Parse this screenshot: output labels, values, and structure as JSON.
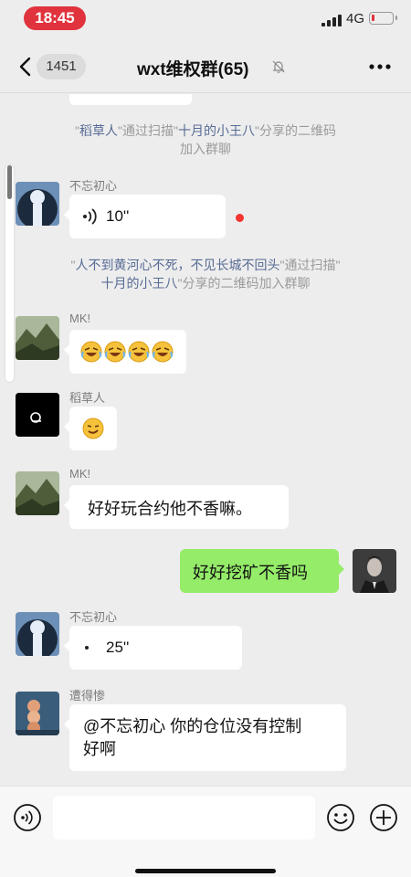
{
  "status_bar": {
    "time": "18:45",
    "network": "4G",
    "battery_level": 0.15
  },
  "header": {
    "unread_count": "1451",
    "title": "wxt维权群(65)"
  },
  "messages": {
    "sys1": {
      "open": "\"",
      "name1": "稻草人",
      "mid": "\"通过扫描\"",
      "name2": "十月的小王八",
      "tail": "\"分享的二维码",
      "line2": "加入群聊"
    },
    "m1": {
      "sender": "不忘初心",
      "duration": "10''",
      "avatar_color": "#2f4f78"
    },
    "sys2": {
      "open": "\"",
      "name1": "人不到黄河心不死，不见长城不回头",
      "mid": "\"通过扫描\"",
      "name2": "十月的小王八",
      "tail": "\"分享的二维码加入群聊"
    },
    "m2": {
      "sender": "MK!",
      "avatar_color": "#5d6a4a"
    },
    "m3": {
      "sender": "稻草人",
      "avatar_color": "#000000"
    },
    "m4": {
      "sender": "MK!",
      "text": "好好玩合约他不香嘛。"
    },
    "m5": {
      "text": "好好挖矿不香吗"
    },
    "m6": {
      "sender": "不忘初心",
      "duration": "25''"
    },
    "m7": {
      "sender": "遭得惨",
      "text_line1": "@不忘初心 你的仓位没有控制",
      "text_line2": "好啊",
      "avatar_color": "#3a5d7c"
    }
  },
  "input": {
    "placeholder": ""
  },
  "icons": {
    "back": "chevron-left-icon",
    "mute": "bell-off-icon",
    "more": "ellipsis-icon",
    "voice": "voice-mode-icon",
    "emoji": "emoji-icon",
    "plus": "plus-circle-icon"
  },
  "colors": {
    "background": "#ededed",
    "bubble_incoming": "#ffffff",
    "bubble_outgoing": "#95ec69",
    "name_link": "#576b95",
    "time_pill": "#e0333d",
    "unread_dot": "#f43530"
  }
}
